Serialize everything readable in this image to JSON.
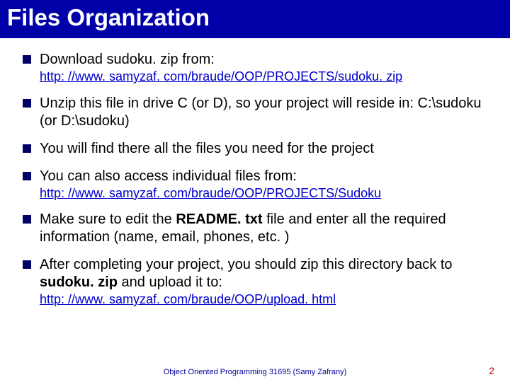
{
  "title": "Files Organization",
  "bullets": [
    {
      "text": "Download sudoku. zip from:",
      "sub_link": "http: //www. samyzaf. com/braude/OOP/PROJECTS/sudoku. zip"
    },
    {
      "text": "Unzip this file in drive C (or D), so your project will reside in: C:\\sudoku (or D:\\sudoku)"
    },
    {
      "text": "You will find there all the files you need for the project"
    },
    {
      "text": "You can also access individual files from:",
      "sub_link": "http: //www. samyzaf. com/braude/OOP/PROJECTS/Sudoku"
    },
    {
      "pre": "Make sure to edit the ",
      "bold": "README. txt",
      "post": " file and enter all the required information (name, email, phones, etc. )"
    },
    {
      "pre": "After completing your project, you should zip this directory back to ",
      "bold": "sudoku. zip",
      "post": " and upload it to:",
      "sub_link": "http: //www. samyzaf. com/braude/OOP/upload. html"
    }
  ],
  "footer": {
    "center": "Object Oriented Programming 31695   (Samy Zafrany)",
    "page": "2"
  }
}
